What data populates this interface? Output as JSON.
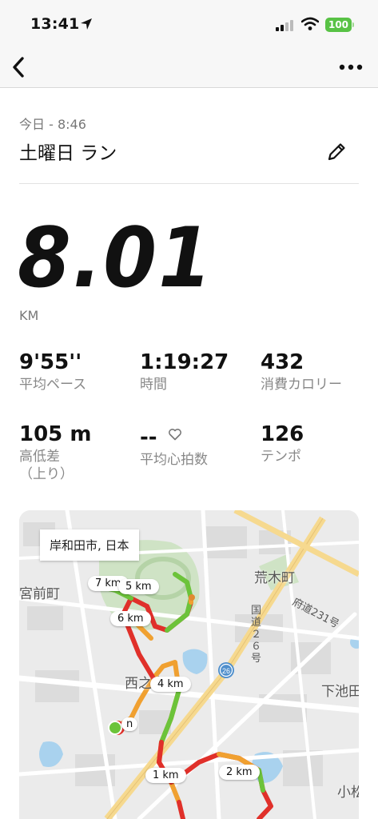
{
  "status": {
    "time": "13:41",
    "battery": "100"
  },
  "header": {
    "date": "今日 - 8:46",
    "title": "土曜日 ラン"
  },
  "summary": {
    "distance": "8.01",
    "distance_unit": "KM"
  },
  "stats": [
    {
      "value": "9'55''",
      "label": "平均ペース"
    },
    {
      "value": "1:19:27",
      "label": "時間"
    },
    {
      "value": "432",
      "label": "消費カロリー"
    },
    {
      "value": "105 m",
      "label": "高低差\n（上り）"
    },
    {
      "value": "--",
      "label": "平均心拍数"
    },
    {
      "value": "126",
      "label": "テンポ"
    }
  ],
  "map": {
    "location_label": "岸和田市, 日本",
    "km_markers": [
      "7 km",
      "5 km",
      "6 km",
      "4 km",
      "1 km",
      "2 km"
    ],
    "start_marker": "n",
    "places": [
      "荒木町",
      "宮前町",
      "西之内町",
      "下池田",
      "小松"
    ],
    "roads": [
      "国道２６号",
      "府道231号",
      "26"
    ],
    "route_colors": {
      "fast": "#6cc33a",
      "mid": "#f0a030",
      "slow": "#e0302a"
    }
  }
}
